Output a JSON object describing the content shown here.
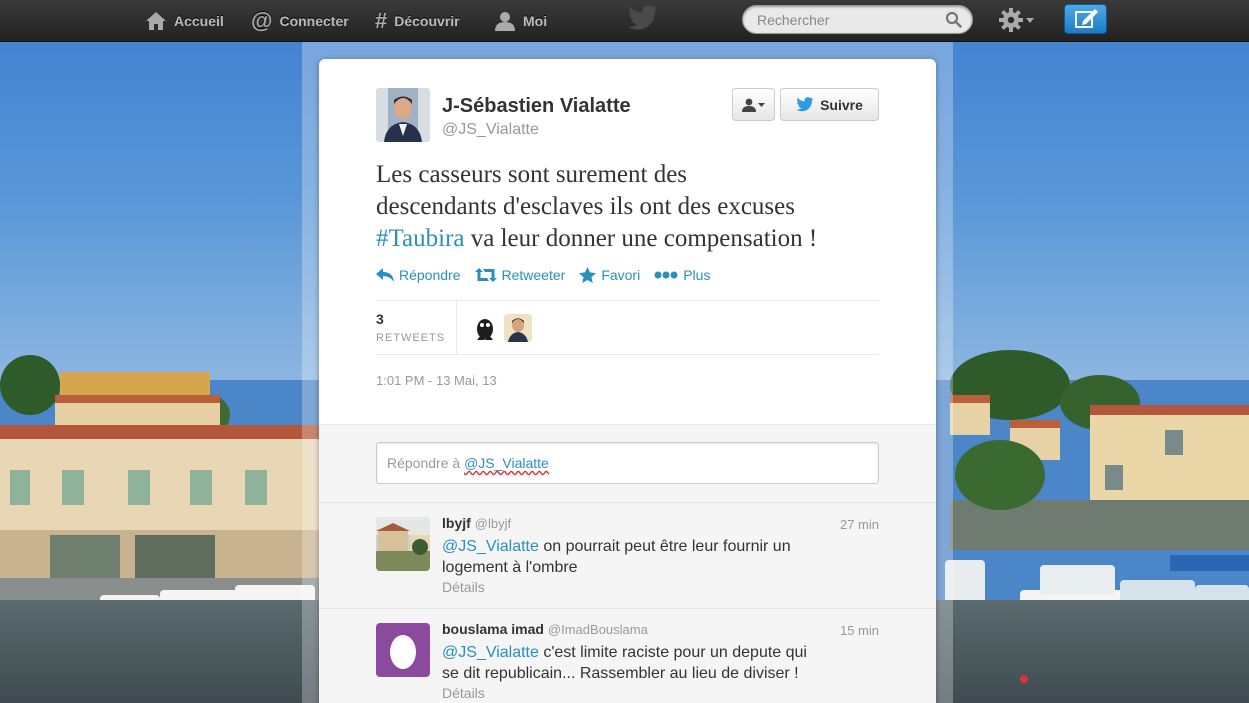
{
  "nav": {
    "home_label": "Accueil",
    "connect_label": "Connecter",
    "discover_label": "Découvrir",
    "me_label": "Moi",
    "search_placeholder": "Rechercher"
  },
  "tweet": {
    "author_name": "J-Sébastien Vialatte",
    "author_handle": "@JS_Vialatte",
    "follow_label": "Suivre",
    "text_line1": "Les casseurs sont surement des",
    "text_line2": "descendants d'esclaves ils ont des excuses",
    "text_hashtag": "#Taubira",
    "text_line3_rest": " va leur donner une compensation !",
    "actions": {
      "reply": "Répondre",
      "retweet": "Retweeter",
      "favorite": "Favori",
      "more": "Plus"
    },
    "retweet_count": "3",
    "retweet_label": "RETWEETS",
    "timestamp": "1:01 PM - 13 Mai, 13"
  },
  "reply_box": {
    "prefix": "Répondre à ",
    "mention": "@JS_Vialatte"
  },
  "replies": [
    {
      "name": "lbyjf",
      "handle": "@lbyjf",
      "time": "27 min",
      "mention": "@JS_Vialatte",
      "text": " on pourrait peut être leur fournir un logement à l'ombre",
      "details": "Détails"
    },
    {
      "name": "bouslama imad",
      "handle": "@ImadBouslama",
      "time": "15 min",
      "mention": "@JS_Vialatte",
      "text": " c'est limite raciste pour un depute qui se dit republicain... Rassembler au lieu de diviser !",
      "details": "Détails"
    }
  ],
  "colors": {
    "link": "#2a8fbf",
    "topbar": "#2a2a2a",
    "compose": "#1d7bc7"
  }
}
